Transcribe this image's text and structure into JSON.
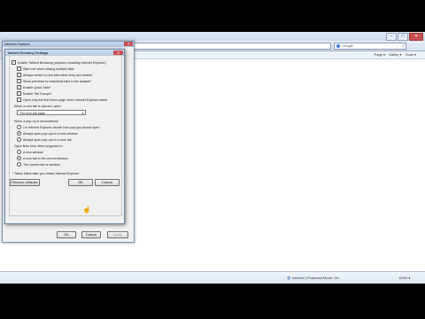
{
  "browser": {
    "window_title": "Internet Optio...",
    "search_placeholder": "Google",
    "toolbar_items": [
      "Page ▾",
      "Safety ▾",
      "Tools ▾"
    ],
    "status_zone": "Internet | Protected Mode: On",
    "zoom": "100% ▾"
  },
  "inet_options": {
    "title": "Internet Options",
    "buttons": {
      "ok": "OK",
      "cancel": "Cancel",
      "apply": "Apply"
    }
  },
  "tabbed_settings": {
    "title": "Tabbed Browsing Settings",
    "enable_label": "Enable Tabbed Browsing (requires restarting Internet Explorer)",
    "options": [
      {
        "label": "Warn me when closing multiple tabs",
        "checked": true
      },
      {
        "label": "Always switch to new tabs when they are created",
        "checked": false
      },
      {
        "label": "Show previews for individual tabs in the taskbar*",
        "checked": true
      },
      {
        "label": "Enable Quick Tabs*",
        "checked": true
      },
      {
        "label": "Enable Tab Groups*",
        "checked": true
      },
      {
        "label": "Open only the first home page when Internet Explorer starts",
        "checked": false
      }
    ],
    "newtab_label": "When a new tab is opened, open:",
    "newtab_value": "The new tab page",
    "popup_label": "When a pop-up is encountered:",
    "popup_options": [
      {
        "label": "Let Internet Explorer decide how pop-ups should open",
        "selected": false
      },
      {
        "label": "Always open pop-ups in a new window",
        "selected": true
      },
      {
        "label": "Always open pop-ups in a new tab",
        "selected": false
      }
    ],
    "links_label": "Open links from other programs in:",
    "links_options": [
      {
        "label": "A new window",
        "selected": false
      },
      {
        "label": "A new tab in the current window",
        "selected": true
      },
      {
        "label": "The current tab or window",
        "selected": false
      }
    ],
    "footnote": "* Takes effect after you restart Internet Explorer",
    "buttons": {
      "restore": "Restore defaults",
      "ok": "OK",
      "cancel": "Cancel"
    }
  }
}
